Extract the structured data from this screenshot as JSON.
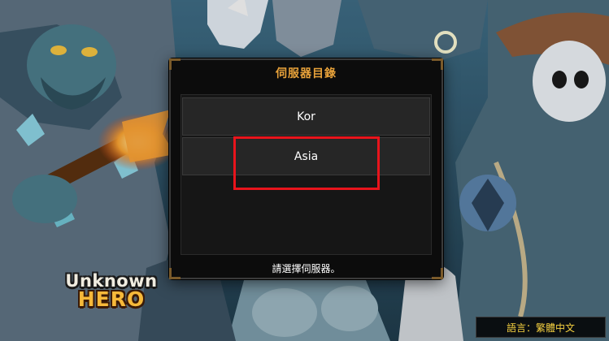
{
  "logo": {
    "line1": "Unknown",
    "line2": "HERO"
  },
  "dialog": {
    "title": "伺服器目錄",
    "servers": [
      {
        "label": "Kor"
      },
      {
        "label": "Asia"
      }
    ],
    "footer": "請選擇伺服器。"
  },
  "language_button": {
    "label": "語言：繁體中文"
  },
  "colors": {
    "accent": "#e8a23a",
    "highlight": "#e8141c",
    "language_text": "#f6d140",
    "logo_hero": "#f6b93a"
  },
  "icons": {
    "background": "cartoon-fantasy-art"
  }
}
